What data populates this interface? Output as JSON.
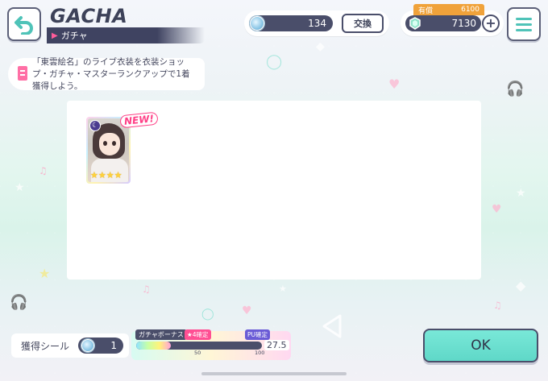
{
  "header": {
    "title": "GACHA",
    "subtitle": "ガチャ"
  },
  "currency": {
    "crystal_amount": "134",
    "exchange_label": "交換",
    "paid_label": "有償",
    "paid_amount": "6100",
    "gem_amount": "7130",
    "plus_label": "+"
  },
  "mission": {
    "text": "「東雲絵名」のライブ衣装を衣装ショップ・ガチャ・マスターランクアップで1着獲得しよう。"
  },
  "result": {
    "new_badge": "NEW!",
    "cards": [
      {
        "attribute": "moon-icon",
        "rarity": 4,
        "stars": "★★★★"
      }
    ]
  },
  "footer": {
    "sticker_label": "獲得シール",
    "sticker_count": "1",
    "bonus_title": "ガチャボーナス",
    "bonus_tag_4star": "★4確定",
    "bonus_tag_pu": "PU確定",
    "bonus_tick_50": "50",
    "bonus_tick_100": "100",
    "bonus_value": "27.5",
    "bonus_progress": 0.275,
    "ok_label": "OK"
  },
  "colors": {
    "accent_teal": "#5fd8c8",
    "dark_navy": "#4a4e6a",
    "pink": "#ff3f86",
    "gold": "#f0a23a"
  }
}
